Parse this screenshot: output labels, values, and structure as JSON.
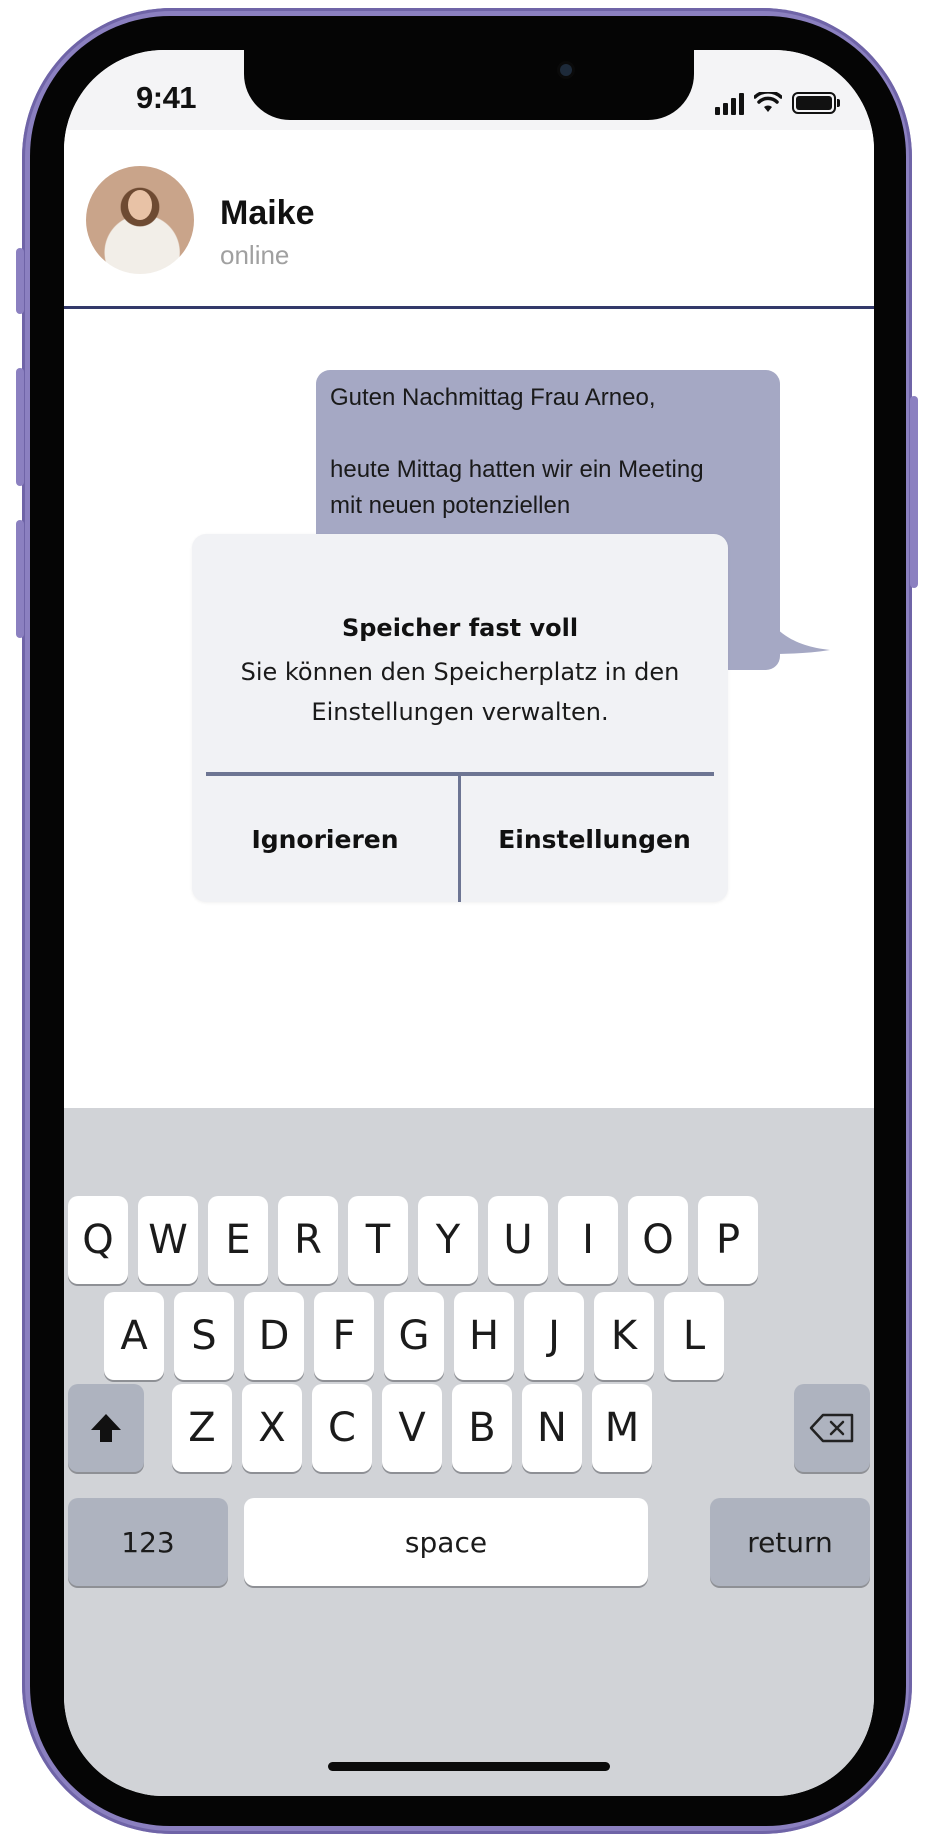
{
  "status_bar": {
    "time": "9:41"
  },
  "contact": {
    "name": "Maike",
    "status": "online"
  },
  "message": {
    "line1": "Guten Nachmittag Frau Arneo,",
    "line2": "heute Mittag hatten wir ein Meeting",
    "line3": "mit neuen potenziellen"
  },
  "alert": {
    "title": "Speicher fast voll",
    "message": "Sie können den Speicherplatz in den Einstellungen verwalten.",
    "ignore_label": "Ignorieren",
    "settings_label": "Einstellungen"
  },
  "keyboard": {
    "row1": [
      "Q",
      "W",
      "E",
      "R",
      "T",
      "Y",
      "U",
      "I",
      "O",
      "P"
    ],
    "row2": [
      "A",
      "S",
      "D",
      "F",
      "G",
      "H",
      "J",
      "K",
      "L"
    ],
    "row3": [
      "Z",
      "X",
      "C",
      "V",
      "B",
      "N",
      "M"
    ],
    "numbers_label": "123",
    "space_label": "space",
    "return_label": "return"
  },
  "colors": {
    "frame": "#8b80c0",
    "bubble": "#a5a8c4",
    "divider": "#33396a",
    "keyboard_bg": "#d1d3d7"
  }
}
